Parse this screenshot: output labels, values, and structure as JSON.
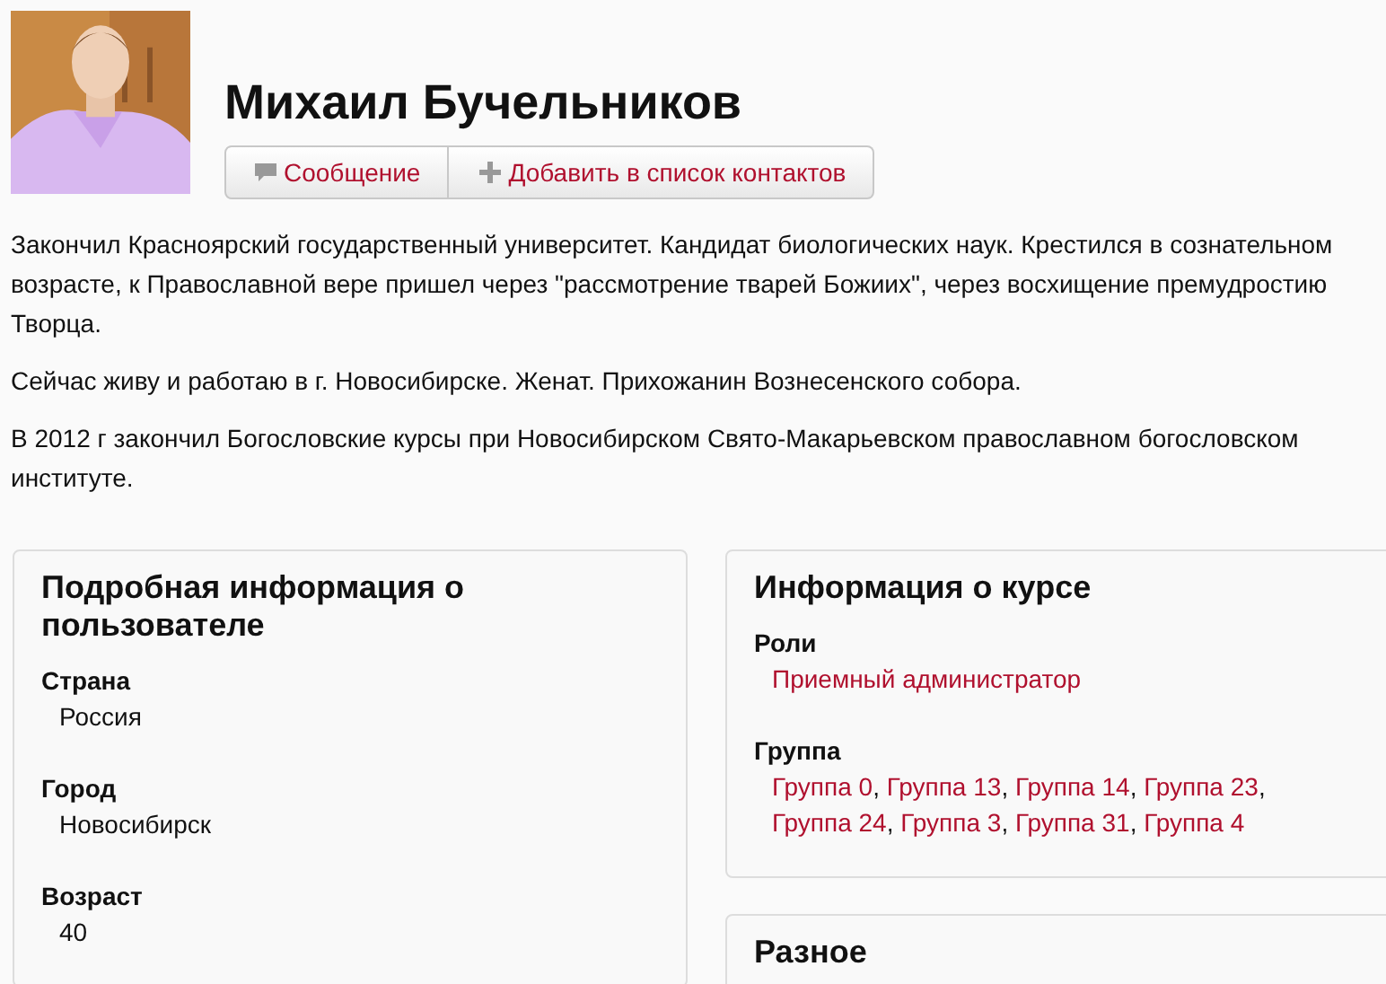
{
  "profile": {
    "name": "Михаил Бучельников",
    "buttons": [
      {
        "label": "Сообщение",
        "kind": "message"
      },
      {
        "label": "Добавить в список контактов",
        "kind": "add"
      }
    ]
  },
  "description": [
    "Закончил Красноярский государственный университет. Кандидат биологических наук. Крестился в сознательном возрасте, к Православной вере пришел через \"рассмотрение тварей Божиих\", через восхищение премудростию Творца.",
    "Сейчас живу и работаю в г. Новосибирске. Женат. Прихожанин Вознесенского собора.",
    "В 2012 г закончил Богословские курсы при Новосибирском Свято-Макарьевском православном богословском институте."
  ],
  "cards": [
    {
      "title": "Подробная информация о пользователе",
      "fields": [
        {
          "label": "Страна",
          "kind": "text",
          "values": [
            "Россия"
          ]
        },
        {
          "label": "Город",
          "kind": "text",
          "values": [
            "Новосибирск"
          ]
        },
        {
          "label": "Возраст",
          "kind": "text",
          "values": [
            "40"
          ]
        }
      ]
    },
    {
      "title": "Информация о курсе",
      "fields": [
        {
          "label": "Роли",
          "kind": "link",
          "values": [
            "Приемный администратор"
          ]
        },
        {
          "label": "Группа",
          "kind": "link",
          "separator": ", ",
          "values": [
            "Группа 0",
            "Группа 13",
            "Группа 14",
            "Группа 23",
            "Группа 24",
            "Группа 3",
            "Группа 31",
            "Группа 4"
          ]
        }
      ]
    },
    {
      "title": "Разное"
    }
  ]
}
